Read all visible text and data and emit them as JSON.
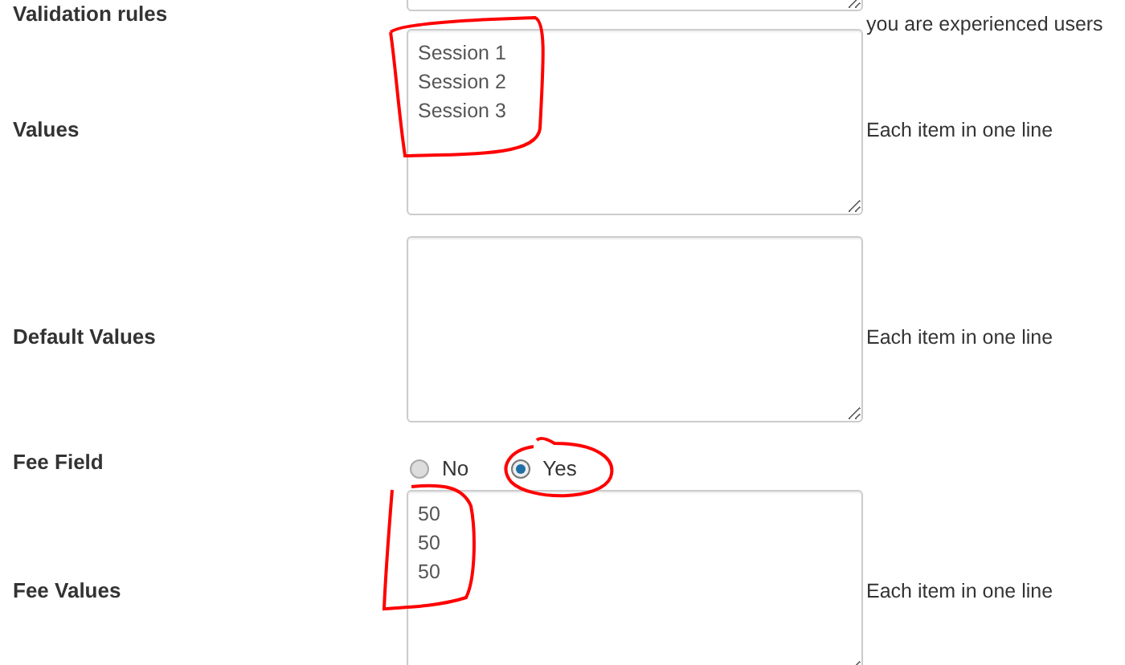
{
  "fields": [
    {
      "kind": "textarea",
      "label": "Validation rules",
      "help": "you are experienced users"
    },
    {
      "kind": "textarea",
      "label": "Values",
      "lines": [
        "Session 1",
        "Session 2",
        "Session 3"
      ],
      "help": "Each item in one line"
    },
    {
      "kind": "textarea",
      "label": "Default Values",
      "help": "Each item in one line"
    },
    {
      "kind": "radio",
      "label": "Fee Field",
      "options": [
        {
          "label": "No",
          "selected": false
        },
        {
          "label": "Yes",
          "selected": true
        }
      ]
    },
    {
      "kind": "textarea",
      "label": "Fee Values",
      "lines": [
        "50",
        "50",
        "50"
      ],
      "help": "Each item in one line"
    }
  ]
}
